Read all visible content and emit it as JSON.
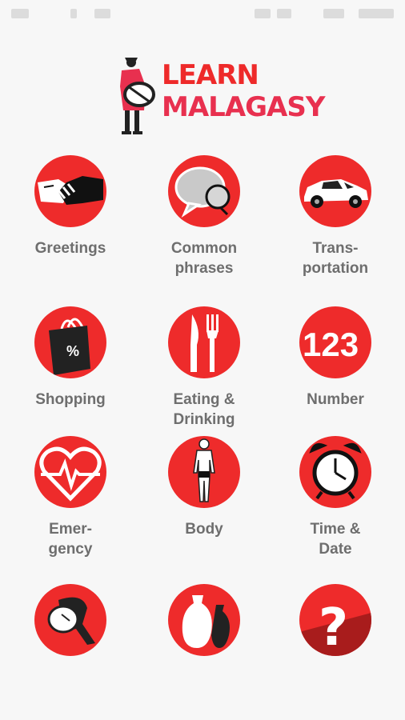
{
  "app": {
    "logo": {
      "line1": "LEARN",
      "line2": "MALAGASY"
    }
  },
  "colors": {
    "accent": "#ee2b2b",
    "label": "#6e6e6e",
    "background": "#f7f7f7"
  },
  "categories": [
    {
      "label": "Greetings",
      "icon": "handshake-icon"
    },
    {
      "label": "Common\nphrases",
      "icon": "speech-bubble-icon"
    },
    {
      "label": "Trans-\nportation",
      "icon": "car-icon"
    },
    {
      "label": "Shopping",
      "icon": "shopping-bag-icon"
    },
    {
      "label": "Eating &\nDrinking",
      "icon": "knife-fork-icon"
    },
    {
      "label": "Number",
      "icon": "numbers-icon",
      "icon_text": "123"
    },
    {
      "label": "Emer-\ngency",
      "icon": "heart-pulse-icon"
    },
    {
      "label": "Body",
      "icon": "body-icon"
    },
    {
      "label": "Time &\nDate",
      "icon": "alarm-clock-icon"
    },
    {
      "label": "",
      "icon": "pot-icon"
    },
    {
      "label": "",
      "icon": "vases-icon"
    },
    {
      "label": "",
      "icon": "question-mark-icon",
      "icon_text": "?"
    }
  ]
}
